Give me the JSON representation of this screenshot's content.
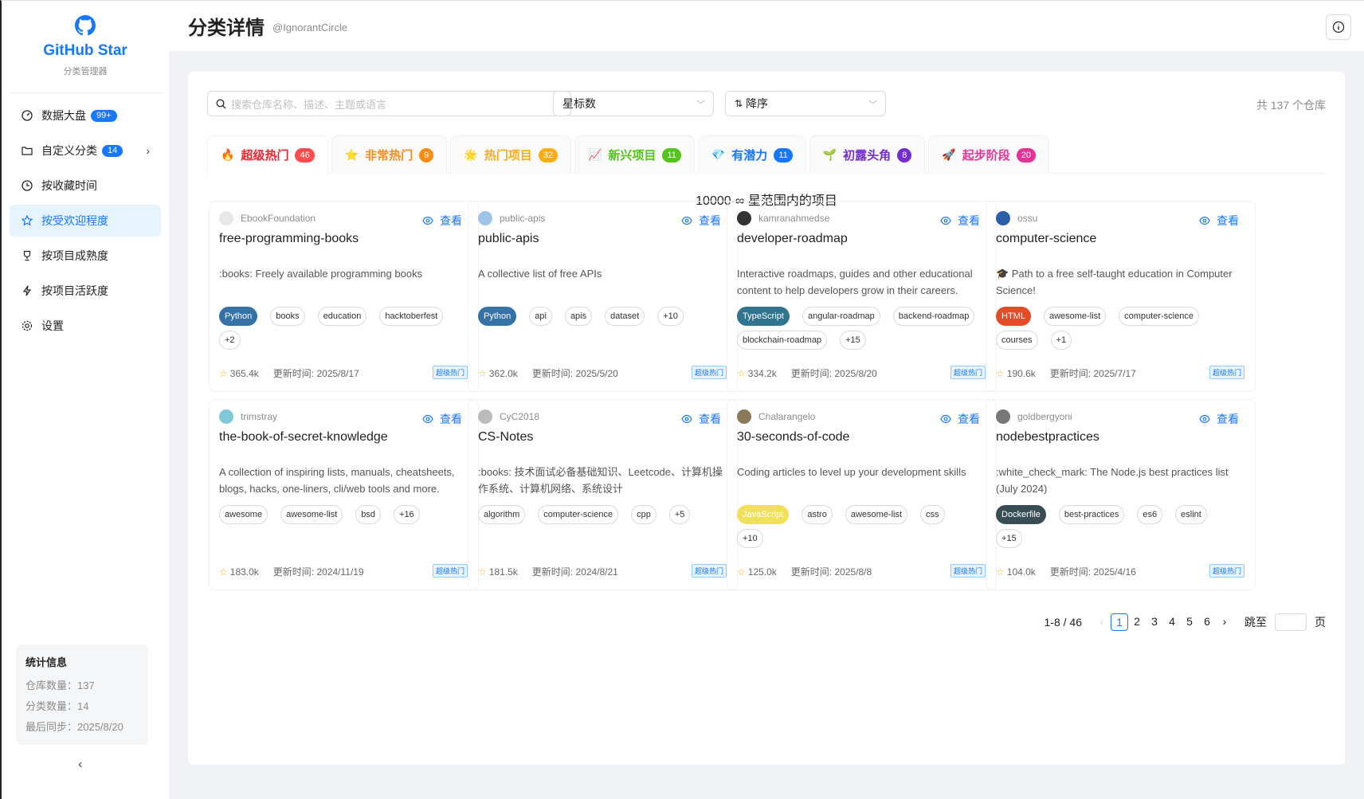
{
  "brand": {
    "title": "GitHub Star",
    "subtitle": "分类管理器"
  },
  "nav": [
    {
      "label": "数据大盘",
      "badge": "99+",
      "icon": "dashboard-icon"
    },
    {
      "label": "自定义分类",
      "badge": "14",
      "icon": "folder-icon",
      "has_chevron": true
    },
    {
      "label": "按收藏时间",
      "icon": "clock-icon"
    },
    {
      "label": "按受欢迎程度",
      "icon": "star-icon",
      "active": true
    },
    {
      "label": "按项目成熟度",
      "icon": "trophy-icon"
    },
    {
      "label": "按项目活跃度",
      "icon": "lightning-icon"
    },
    {
      "label": "设置",
      "icon": "gear-icon"
    }
  ],
  "stats": {
    "title": "统计信息",
    "repo_count": "仓库数量：137",
    "category_count": "分类数量：14",
    "last_sync": "最后同步：2025/8/20"
  },
  "header": {
    "title": "分类详情",
    "user": "@IgnorantCircle"
  },
  "toolbar": {
    "search_placeholder": "搜索仓库名称、描述、主题或语言",
    "sort_field": "星标数",
    "sort_order": "降序",
    "total": "共 137 个仓库"
  },
  "tabs": [
    {
      "emoji": "🔥",
      "label": "超级热门",
      "count": "46",
      "color": "#f5222d",
      "badge": "#ff4d4f"
    },
    {
      "emoji": "⭐",
      "label": "非常热门",
      "count": "9",
      "color": "#fa8c16",
      "badge": "#fa8c16"
    },
    {
      "emoji": "🌟",
      "label": "热门项目",
      "count": "32",
      "color": "#faad14",
      "badge": "#faad14"
    },
    {
      "emoji": "📈",
      "label": "新兴项目",
      "count": "11",
      "color": "#52c41a",
      "badge": "#52c41a"
    },
    {
      "emoji": "💎",
      "label": "有潜力",
      "count": "11",
      "color": "#1677ff",
      "badge": "#1677ff"
    },
    {
      "emoji": "🌱",
      "label": "初露头角",
      "count": "8",
      "color": "#722ed1",
      "badge": "#722ed1"
    },
    {
      "emoji": "🚀",
      "label": "起步阶段",
      "count": "20",
      "color": "#eb2f96",
      "badge": "#eb2f96"
    }
  ],
  "range_title": "10000-∞ 星范围内的项目",
  "view_label": "查看",
  "repos": [
    {
      "owner": "EbookFoundation",
      "name": "free-programming-books",
      "desc": ":books: Freely available programming books",
      "lang": "Python",
      "lang_color": "#3572A5",
      "tags": [
        "books",
        "education",
        "hacktoberfest",
        "+2"
      ],
      "stars": "365.4k",
      "updated": "更新时间: 2025/8/17",
      "level": "超级热门",
      "avatar_color": "#e8e8e8"
    },
    {
      "owner": "public-apis",
      "name": "public-apis",
      "desc": "A collective list of free APIs",
      "lang": "Python",
      "lang_color": "#3572A5",
      "tags": [
        "api",
        "apis",
        "dataset",
        "+10"
      ],
      "stars": "362.0k",
      "updated": "更新时间: 2025/5/20",
      "level": "超级热门",
      "avatar_color": "#a0c4e8"
    },
    {
      "owner": "kamranahmedse",
      "name": "developer-roadmap",
      "desc": "Interactive roadmaps, guides and other educational content to help developers grow in their careers.",
      "lang": "TypeScript",
      "lang_color": "#31748f",
      "tags": [
        "angular-roadmap",
        "backend-roadmap",
        "blockchain-roadmap",
        "+15"
      ],
      "stars": "334.2k",
      "updated": "更新时间: 2025/8/20",
      "level": "超级热门",
      "avatar_color": "#333333"
    },
    {
      "owner": "ossu",
      "name": "computer-science",
      "desc": "🎓 Path to a free self-taught education in Computer Science!",
      "lang": "HTML",
      "lang_color": "#e34c26",
      "tags": [
        "awesome-list",
        "computer-science",
        "courses",
        "+1"
      ],
      "stars": "190.6k",
      "updated": "更新时间: 2025/7/17",
      "level": "超级热门",
      "avatar_color": "#2b5fa8"
    },
    {
      "owner": "trimstray",
      "name": "the-book-of-secret-knowledge",
      "desc": "A collection of inspiring lists, manuals, cheatsheets, blogs, hacks, one-liners, cli/web tools and more.",
      "lang": "",
      "lang_color": "",
      "tags": [
        "awesome",
        "awesome-list",
        "bsd",
        "+16"
      ],
      "stars": "183.0k",
      "updated": "更新时间: 2024/11/19",
      "level": "超级热门",
      "avatar_color": "#7fc7d9"
    },
    {
      "owner": "CyC2018",
      "name": "CS-Notes",
      "desc": ":books: 技术面试必备基础知识、Leetcode、计算机操作系统、计算机网络、系统设计",
      "lang": "",
      "lang_color": "",
      "tags": [
        "algorithm",
        "computer-science",
        "cpp",
        "+5"
      ],
      "stars": "181.5k",
      "updated": "更新时间: 2024/8/21",
      "level": "超级热门",
      "avatar_color": "#bbbbbb"
    },
    {
      "owner": "Chalarangelo",
      "name": "30-seconds-of-code",
      "desc": "Coding articles to level up your development skills",
      "lang": "JavaScript",
      "lang_color": "#f1e05a",
      "tags": [
        "astro",
        "awesome-list",
        "css",
        "+10"
      ],
      "stars": "125.0k",
      "updated": "更新时间: 2025/8/8",
      "level": "超级热门",
      "avatar_color": "#8a7a5a"
    },
    {
      "owner": "goldbergyoni",
      "name": "nodebestpractices",
      "desc": ":white_check_mark: The Node.js best practices list (July 2024)",
      "lang": "Dockerfile",
      "lang_color": "#384d54",
      "tags": [
        "best-practices",
        "es6",
        "eslint",
        "+15"
      ],
      "stars": "104.0k",
      "updated": "更新时间: 2025/4/16",
      "level": "超级热门",
      "avatar_color": "#777777"
    }
  ],
  "pager": {
    "range": "1-8 / 46",
    "pages": [
      "1",
      "2",
      "3",
      "4",
      "5",
      "6"
    ],
    "current": "1",
    "jump_label": "跳至",
    "page_suffix": "页"
  }
}
